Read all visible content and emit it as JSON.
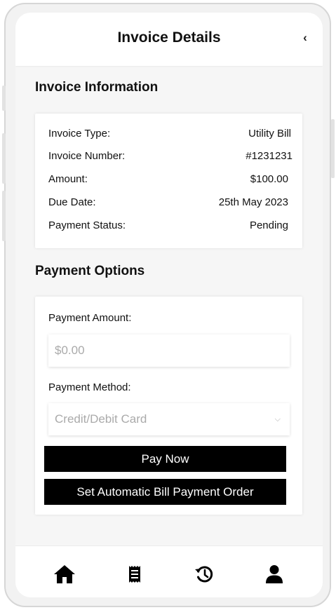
{
  "header": {
    "title": "Invoice Details",
    "back_symbol": "‹",
    "back_icon": "chevron-left-icon"
  },
  "invoice_info": {
    "title": "Invoice Information",
    "rows": [
      {
        "label": "Invoice Type:",
        "value": "Utility Bill"
      },
      {
        "label": "Invoice Number:",
        "value": "#1231231"
      },
      {
        "label": "Amount:",
        "value": "$100.00"
      },
      {
        "label": "Due Date:",
        "value": "25th May 2023"
      },
      {
        "label": "Payment Status:",
        "value": "Pending"
      }
    ]
  },
  "payment_options": {
    "title": "Payment Options",
    "amount_label": "Payment Amount:",
    "amount_placeholder": "$0.00",
    "method_label": "Payment Method:",
    "method_selected": "Credit/Debit Card",
    "pay_button": "Pay Now",
    "auto_button": "Set Automatic Bill Payment Order"
  },
  "bottom_nav": {
    "items": [
      {
        "icon": "home-icon"
      },
      {
        "icon": "receipt-icon"
      },
      {
        "icon": "history-icon"
      },
      {
        "icon": "profile-icon"
      }
    ]
  },
  "colors": {
    "button_bg": "#000000",
    "button_text": "#ffffff",
    "placeholder_text": "#aaaaaa"
  }
}
